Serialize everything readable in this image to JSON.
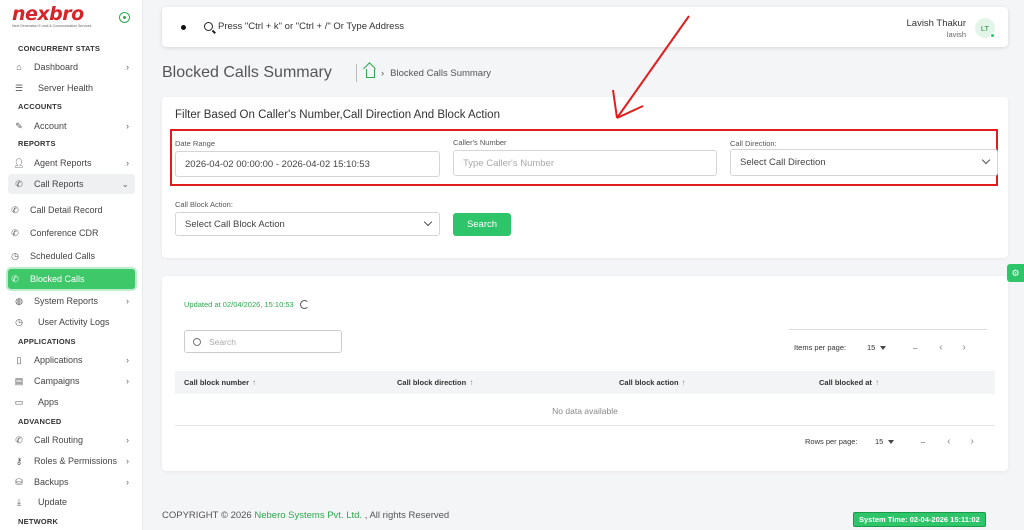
{
  "brand": {
    "logo": "nexbro",
    "tagline": "Next Generation E-mail & Communication Services",
    "accent": "#2ec56a",
    "logo_color": "#d6242a"
  },
  "sidebar": {
    "sections": {
      "concurrent": "CONCURRENT STATS",
      "accounts": "ACCOUNTS",
      "reports": "REPORTS",
      "applications": "APPLICATIONS",
      "advanced": "ADVANCED",
      "network": "NETWORK"
    },
    "items": {
      "dashboard": "Dashboard",
      "server_health": "Server Health",
      "account": "Account",
      "agent_reports": "Agent Reports",
      "call_reports": "Call Reports",
      "call_detail_record": "Call Detail Record",
      "conference_cdr": "Conference CDR",
      "scheduled_calls": "Scheduled Calls",
      "blocked_calls": "Blocked Calls",
      "system_reports": "System Reports",
      "user_activity_logs": "User Activity Logs",
      "applications": "Applications",
      "campaigns": "Campaigns",
      "apps": "Apps",
      "call_routing": "Call Routing",
      "roles_permissions": "Roles & Permissions",
      "backups": "Backups",
      "update": "Update"
    }
  },
  "topbar": {
    "search_hint": "Press \"Ctrl + k\" or \"Ctrl + /\" Or Type Address",
    "user_name": "Lavish Thakur",
    "user_id": "lavish",
    "avatar_initials": "LT"
  },
  "page": {
    "title": "Blocked Calls Summary",
    "breadcrumb": "Blocked Calls Summary"
  },
  "filter": {
    "title": "Filter Based On Caller's Number,Call Direction And Block Action",
    "date_range_label": "Date Range",
    "date_range_value": "2026-04-02 00:00:00 - 2026-04-02 15:10:53",
    "callers_number_label": "Caller's Number",
    "callers_number_placeholder": "Type Caller's Number",
    "call_direction_label": "Call Direction:",
    "call_direction_value": "Select Call Direction",
    "call_block_action_label": "Call Block Action:",
    "call_block_action_value": "Select Call Block Action",
    "search_button": "Search"
  },
  "table": {
    "updated_text": "Updated at 02/04/2026, 15:10:53",
    "search_placeholder": "Search",
    "items_per_page_label": "Items per page:",
    "items_per_page_value": "15",
    "range_text": "–",
    "rows_per_page_label": "Rows per page:",
    "rows_per_page_value": "15",
    "columns": [
      "Call block number",
      "Call block direction",
      "Call block action",
      "Call blocked at"
    ],
    "empty_text": "No data available"
  },
  "footer": {
    "copyright_prefix": "COPYRIGHT © 2026 ",
    "company": "Nebero Systems Pvt. Ltd.",
    "copyright_suffix": " , All rights Reserved",
    "system_time": "System Time: 02-04-2026 15:11:02"
  }
}
